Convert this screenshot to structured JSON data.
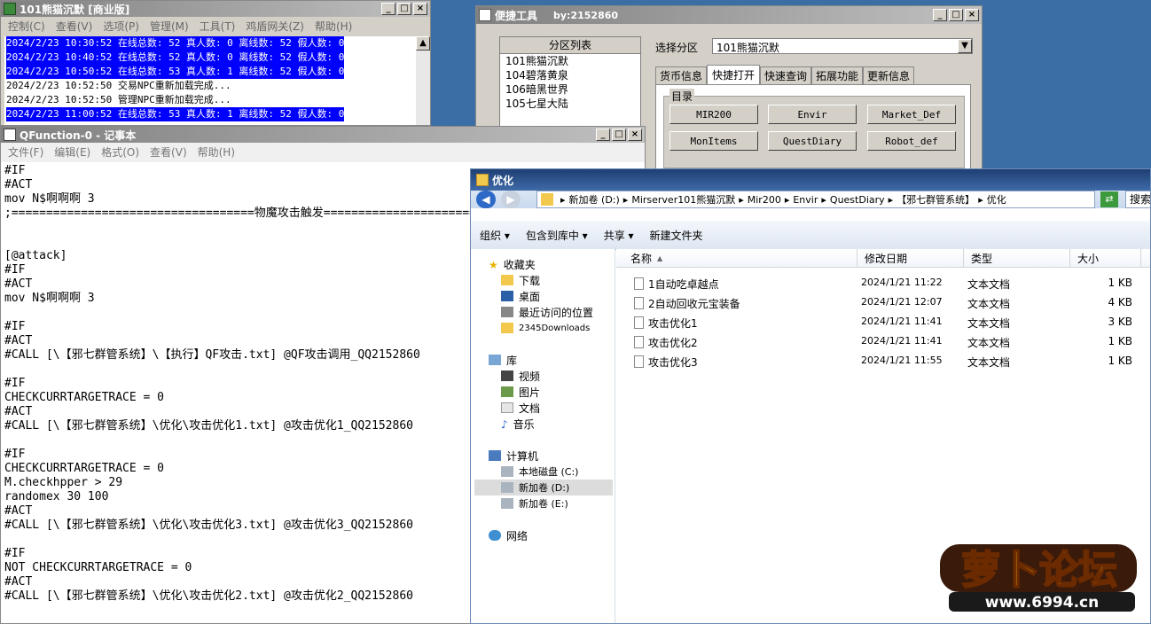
{
  "log_window": {
    "title": "101熊猫沉默 [商业版]",
    "menu": [
      "控制(C)",
      "查看(V)",
      "选项(P)",
      "管理(M)",
      "工具(T)",
      "鸡盾网关(Z)",
      "帮助(H)"
    ],
    "lines": [
      {
        "text": "2024/2/23 10:30:52 在线总数: 52 真人数: 0 离线数: 52 假人数: 0",
        "highlight": true
      },
      {
        "text": "2024/2/23 10:40:52 在线总数: 52 真人数: 0 离线数: 52 假人数: 0",
        "highlight": true
      },
      {
        "text": "2024/2/23 10:50:52 在线总数: 53 真人数: 1 离线数: 52 假人数: 0",
        "highlight": true
      },
      {
        "text": "2024/2/23 10:52:50 交易NPC重新加载完成...",
        "highlight": false
      },
      {
        "text": "2024/2/23 10:52:50 管理NPC重新加载完成...",
        "highlight": false
      },
      {
        "text": "2024/2/23 11:00:52 在线总数: 53 真人数: 1 离线数: 52 假人数: 0",
        "highlight": true
      }
    ]
  },
  "tool_window": {
    "title": "便捷工具",
    "by": "by:2152860",
    "partition_header": "分区列表",
    "partitions": [
      "101熊猫沉默",
      "104碧落黄泉",
      "106暗黑世界",
      "105七星大陆"
    ],
    "select_label": "选择分区",
    "select_value": "101熊猫沉默",
    "tabs": [
      "货币信息",
      "快捷打开",
      "快速查询",
      "拓展功能",
      "更新信息"
    ],
    "active_tab": "快捷打开",
    "group_label": "目录",
    "buttons": [
      "MIR200",
      "Envir",
      "Market_Def",
      "MonItems",
      "QuestDiary",
      "Robot_def"
    ]
  },
  "notepad": {
    "title": "QFunction-0 - 记事本",
    "menu": [
      "文件(F)",
      "编辑(E)",
      "格式(O)",
      "查看(V)",
      "帮助(H)"
    ],
    "lines": [
      "#IF",
      "#ACT",
      "mov N$啊啊啊 3",
      ";===================================物魔攻击触发==================================",
      "",
      "",
      "[@attack]",
      "#IF",
      "#ACT",
      "mov N$啊啊啊 3",
      "",
      "#IF",
      "#ACT",
      "#CALL [\\【邪七群管系统】\\【执行】QF攻击.txt] @QF攻击调用_QQ2152860",
      "",
      "#IF",
      "CHECKCURRTARGETRACE = 0",
      "#ACT",
      "#CALL [\\【邪七群管系统】\\优化\\攻击优化1.txt] @攻击优化1_QQ2152860",
      "",
      "#IF",
      "CHECKCURRTARGETRACE = 0",
      "M.checkhpper > 29",
      "randomex 30 100",
      "#ACT",
      "#CALL [\\【邪七群管系统】\\优化\\攻击优化3.txt] @攻击优化3_QQ2152860",
      "",
      "#IF",
      "NOT CHECKCURRTARGETRACE = 0",
      "#ACT",
      "#CALL [\\【邪七群管系统】\\优化\\攻击优化2.txt] @攻击优化2_QQ2152860"
    ]
  },
  "explorer": {
    "title": "优化",
    "breadcrumb": [
      "新加卷 (D:)",
      "Mirserver101熊猫沉默",
      "Mir200",
      "Envir",
      "QuestDiary",
      "【邪七群管系统】",
      "优化"
    ],
    "search_placeholder": "搜索",
    "toolbar": [
      "组织 ▾",
      "包含到库中 ▾",
      "共享 ▾",
      "新建文件夹"
    ],
    "nav": {
      "favorites": "收藏夹",
      "favorites_items": [
        "下载",
        "桌面",
        "最近访问的位置",
        "2345Downloads"
      ],
      "libraries": "库",
      "libraries_items": [
        "视频",
        "图片",
        "文档",
        "音乐"
      ],
      "computer": "计算机",
      "computer_items": [
        "本地磁盘 (C:)",
        "新加卷 (D:)",
        "新加卷 (E:)"
      ],
      "network": "网络"
    },
    "columns": [
      "名称",
      "修改日期",
      "类型",
      "大小"
    ],
    "files": [
      {
        "name": "1自动吃卓越点",
        "date": "2024/1/21 11:22",
        "type": "文本文档",
        "size": "1 KB"
      },
      {
        "name": "2自动回收元宝装备",
        "date": "2024/1/21 12:07",
        "type": "文本文档",
        "size": "4 KB"
      },
      {
        "name": "攻击优化1",
        "date": "2024/1/21 11:41",
        "type": "文本文档",
        "size": "3 KB"
      },
      {
        "name": "攻击优化2",
        "date": "2024/1/21 11:41",
        "type": "文本文档",
        "size": "1 KB"
      },
      {
        "name": "攻击优化3",
        "date": "2024/1/21 11:55",
        "type": "文本文档",
        "size": "1 KB"
      }
    ]
  },
  "watermark": {
    "text": "萝卜论坛",
    "url": "www.6994.cn"
  }
}
